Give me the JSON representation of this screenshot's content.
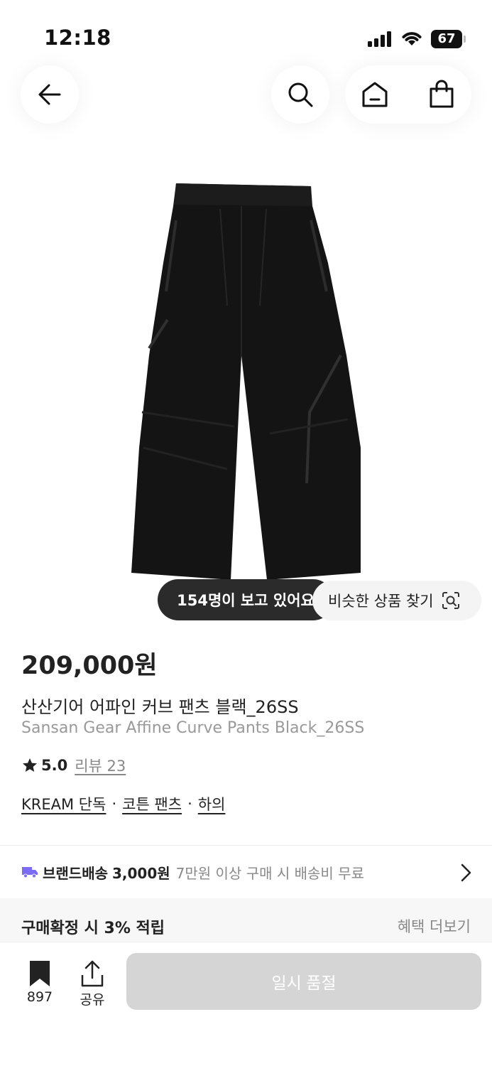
{
  "status_bar": {
    "time": "12:18",
    "battery": "67"
  },
  "nav": {
    "back": "back-arrow-icon",
    "search": "search-icon",
    "home": "home-icon",
    "cart": "shopping-bag-icon"
  },
  "product": {
    "image": "black-pants-photo",
    "viewers_text": "154명이 보고 있어요",
    "similar_text": "비슷한 상품 찾기",
    "price": "209,000원",
    "title_ko": "산산기어 어파인 커브 팬츠 블랙_26SS",
    "title_en": "Sansan Gear Affine Curve Pants Black_26SS",
    "rating": "5.0",
    "review_link": "리뷰 23",
    "tags": [
      "KREAM 단독",
      "코튼 팬츠",
      "하의"
    ],
    "tag_separator": "·"
  },
  "shipping": {
    "label": "브랜드배송",
    "fee": "3,000원",
    "note": "7만원 이상 구매 시 배송비 무료"
  },
  "benefit": {
    "text": "구매확정 시 3% 적립",
    "more": "혜택 더보기"
  },
  "bottom_bar": {
    "bookmark_count": "897",
    "share_label": "공유",
    "buy_label": "일시 품절"
  },
  "colors": {
    "accent_purple": "#7b6cf6",
    "dark_pill": "#2b2b2b",
    "disabled_button": "#d5d5d5"
  }
}
